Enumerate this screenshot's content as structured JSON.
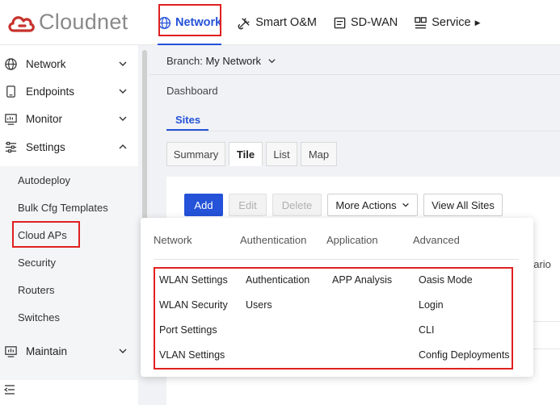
{
  "brand": {
    "name": "Cloudnet",
    "color": "#c8322d"
  },
  "topnav": {
    "items": [
      {
        "label": "Network",
        "icon": "globe-icon",
        "active": true
      },
      {
        "label": "Smart O&M",
        "icon": "tools-icon"
      },
      {
        "label": "SD-WAN",
        "icon": "sdwan-icon"
      },
      {
        "label": "Service",
        "icon": "service-grid-icon"
      }
    ],
    "accent": "#2452d8"
  },
  "sidebar": {
    "items": [
      {
        "label": "Network",
        "icon": "globe-icon"
      },
      {
        "label": "Endpoints",
        "icon": "device-icon"
      },
      {
        "label": "Monitor",
        "icon": "monitor-icon"
      },
      {
        "label": "Settings",
        "icon": "sliders-icon"
      },
      {
        "label": "Maintain",
        "icon": "maintain-icon"
      }
    ],
    "subitems": [
      "Autodeploy",
      "Bulk Cfg Templates",
      "Cloud APs",
      "Security",
      "Routers",
      "Switches"
    ]
  },
  "branch": {
    "prefix": "Branch:",
    "value": "My Network"
  },
  "breadcrumb": "Dashboard",
  "sites_tab": "Sites",
  "view_tabs": [
    "Summary",
    "Tile",
    "List",
    "Map"
  ],
  "actions": {
    "add": "Add",
    "edit": "Edit",
    "delete": "Delete",
    "more": "More Actions",
    "view_all": "View All Sites"
  },
  "partial_text": "nario",
  "menu": {
    "columns": [
      "Network",
      "Authentication",
      "Application",
      "Advanced"
    ],
    "network": [
      "WLAN Settings",
      "WLAN Security",
      "Port Settings",
      "VLAN Settings"
    ],
    "authentication": [
      "Authentication",
      "Users"
    ],
    "application": [
      "APP Analysis"
    ],
    "advanced": [
      "Oasis Mode",
      "Login",
      "CLI",
      "Config Deployments"
    ]
  }
}
